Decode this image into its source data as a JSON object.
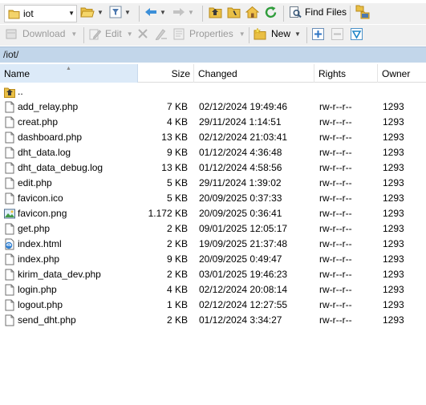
{
  "toolbar_top": {
    "folder_name": "iot",
    "find_files_label": "Find Files"
  },
  "toolbar_bottom": {
    "download_label": "Download",
    "edit_label": "Edit",
    "properties_label": "Properties",
    "new_label": "New"
  },
  "path": "/iot/",
  "columns": {
    "name": "Name",
    "size": "Size",
    "changed": "Changed",
    "rights": "Rights",
    "owner": "Owner"
  },
  "parent_dir": "..",
  "files": [
    {
      "name": "add_relay.php",
      "size": "7 KB",
      "changed": "02/12/2024 19:49:46",
      "rights": "rw-r--r--",
      "owner": "1293",
      "icon": "document-icon"
    },
    {
      "name": "creat.php",
      "size": "4 KB",
      "changed": "29/11/2024 1:14:51",
      "rights": "rw-r--r--",
      "owner": "1293",
      "icon": "document-icon"
    },
    {
      "name": "dashboard.php",
      "size": "13 KB",
      "changed": "02/12/2024 21:03:41",
      "rights": "rw-r--r--",
      "owner": "1293",
      "icon": "document-icon"
    },
    {
      "name": "dht_data.log",
      "size": "9 KB",
      "changed": "01/12/2024 4:36:48",
      "rights": "rw-r--r--",
      "owner": "1293",
      "icon": "document-icon"
    },
    {
      "name": "dht_data_debug.log",
      "size": "13 KB",
      "changed": "01/12/2024 4:58:56",
      "rights": "rw-r--r--",
      "owner": "1293",
      "icon": "document-icon"
    },
    {
      "name": "edit.php",
      "size": "5 KB",
      "changed": "29/11/2024 1:39:02",
      "rights": "rw-r--r--",
      "owner": "1293",
      "icon": "document-icon"
    },
    {
      "name": "favicon.ico",
      "size": "5 KB",
      "changed": "20/09/2025 0:37:33",
      "rights": "rw-r--r--",
      "owner": "1293",
      "icon": "document-icon"
    },
    {
      "name": "favicon.png",
      "size": "1.172 KB",
      "changed": "20/09/2025 0:36:41",
      "rights": "rw-r--r--",
      "owner": "1293",
      "icon": "image-icon"
    },
    {
      "name": "get.php",
      "size": "2 KB",
      "changed": "09/01/2025 12:05:17",
      "rights": "rw-r--r--",
      "owner": "1293",
      "icon": "document-icon"
    },
    {
      "name": "index.html",
      "size": "2 KB",
      "changed": "19/09/2025 21:37:48",
      "rights": "rw-r--r--",
      "owner": "1293",
      "icon": "html-icon"
    },
    {
      "name": "index.php",
      "size": "9 KB",
      "changed": "20/09/2025 0:49:47",
      "rights": "rw-r--r--",
      "owner": "1293",
      "icon": "document-icon"
    },
    {
      "name": "kirim_data_dev.php",
      "size": "2 KB",
      "changed": "03/01/2025 19:46:23",
      "rights": "rw-r--r--",
      "owner": "1293",
      "icon": "document-icon"
    },
    {
      "name": "login.php",
      "size": "4 KB",
      "changed": "02/12/2024 20:08:14",
      "rights": "rw-r--r--",
      "owner": "1293",
      "icon": "document-icon"
    },
    {
      "name": "logout.php",
      "size": "1 KB",
      "changed": "02/12/2024 12:27:55",
      "rights": "rw-r--r--",
      "owner": "1293",
      "icon": "document-icon"
    },
    {
      "name": "send_dht.php",
      "size": "2 KB",
      "changed": "01/12/2024 3:34:27",
      "rights": "rw-r--r--",
      "owner": "1293",
      "icon": "document-icon"
    }
  ]
}
